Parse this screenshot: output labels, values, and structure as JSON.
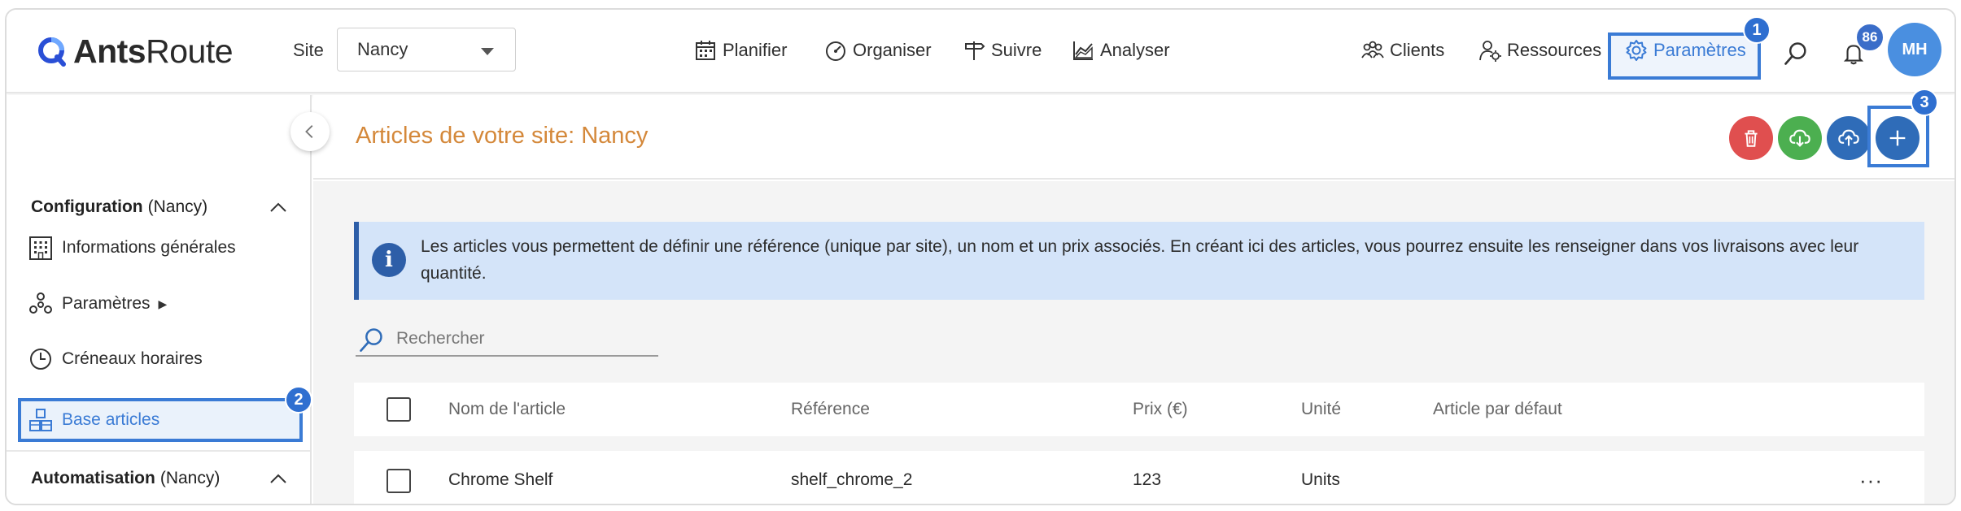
{
  "app": {
    "logo_bold": "Ants",
    "logo_light": "Route"
  },
  "header": {
    "site_label": "Site",
    "site_value": "Nancy",
    "nav": [
      "Planifier",
      "Organiser",
      "Suivre",
      "Analyser"
    ],
    "right": {
      "clients": "Clients",
      "ressources": "Ressources",
      "parametres": "Paramètres"
    },
    "notifications": "86",
    "avatar": "MH"
  },
  "markers": [
    "1",
    "2",
    "3"
  ],
  "sidebar": {
    "config_title": "Configuration",
    "config_site": "(Nancy)",
    "items": [
      "Informations générales",
      "Paramètres",
      "Créneaux horaires",
      "Base articles"
    ],
    "params_arrow": "▶",
    "automation_title": "Automatisation",
    "automation_site": "(Nancy)"
  },
  "main": {
    "title": "Articles de votre site: Nancy",
    "info": "Les articles vous permettent de définir une référence (unique par site), un nom et un prix associés. En créant ici des articles, vous pourrez ensuite les renseigner dans vos livraisons avec leur quantité.",
    "info_icon": "i",
    "search_placeholder": "Rechercher",
    "columns": [
      "Nom de l'article",
      "Référence",
      "Prix (€)",
      "Unité",
      "Article par défaut"
    ],
    "rows": [
      {
        "name": "Chrome Shelf",
        "reference": "shelf_chrome_2",
        "price": "123",
        "unit": "Units",
        "default": ""
      }
    ],
    "row_more": "···"
  },
  "colors": {
    "accent": "#3a7bd5",
    "title": "#d4883a",
    "delete": "#e04f4f",
    "download": "#4caf50",
    "upload": "#2f6cb8",
    "add": "#2f6cb8"
  }
}
